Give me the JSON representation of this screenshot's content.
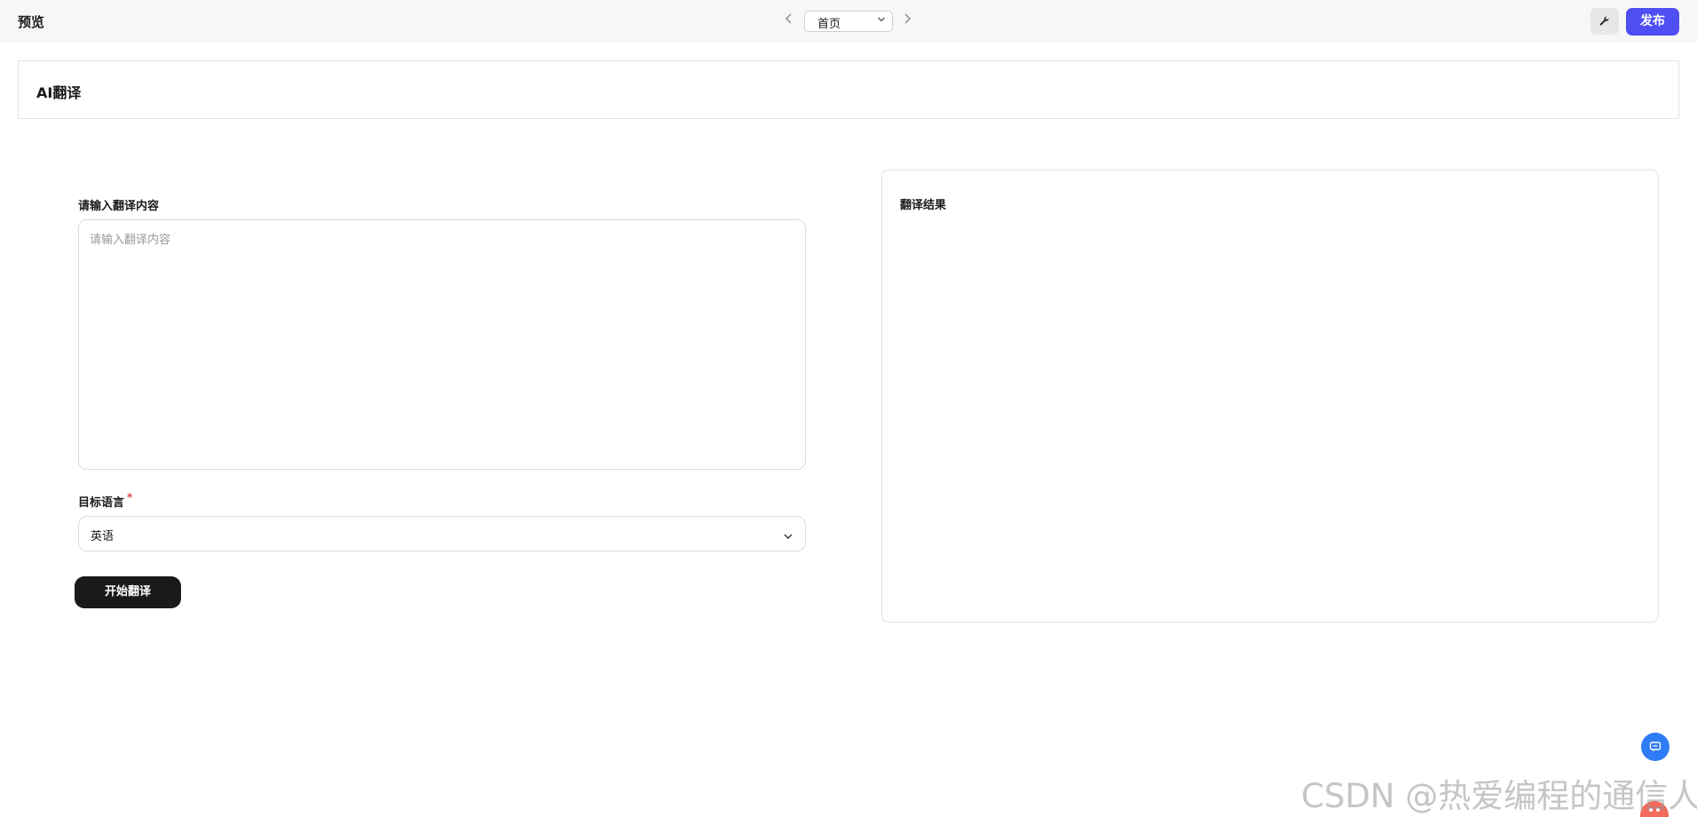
{
  "topbar": {
    "title": "预览",
    "page_select": "首页",
    "publish_label": "发布"
  },
  "header": {
    "app_title": "AI翻译"
  },
  "form": {
    "input_label": "请输入翻译内容",
    "input_placeholder": "请输入翻译内容",
    "input_value": "",
    "language_label": "目标语言",
    "required_mark": "*",
    "language_value": "英语",
    "start_button": "开始翻译"
  },
  "result": {
    "label": "翻译结果",
    "content": ""
  },
  "icons": {
    "prev": "chevron-left-icon",
    "next": "chevron-right-icon",
    "dropdown": "chevron-down-icon",
    "tool": "wrench-icon",
    "chat": "chat-icon"
  },
  "colors": {
    "accent": "#4e4ef2",
    "primary_button": "#1a1a1a",
    "required": "#e5484d",
    "float_button": "#2f7df6"
  },
  "watermark": "CSDN @热爱编程的通信人"
}
